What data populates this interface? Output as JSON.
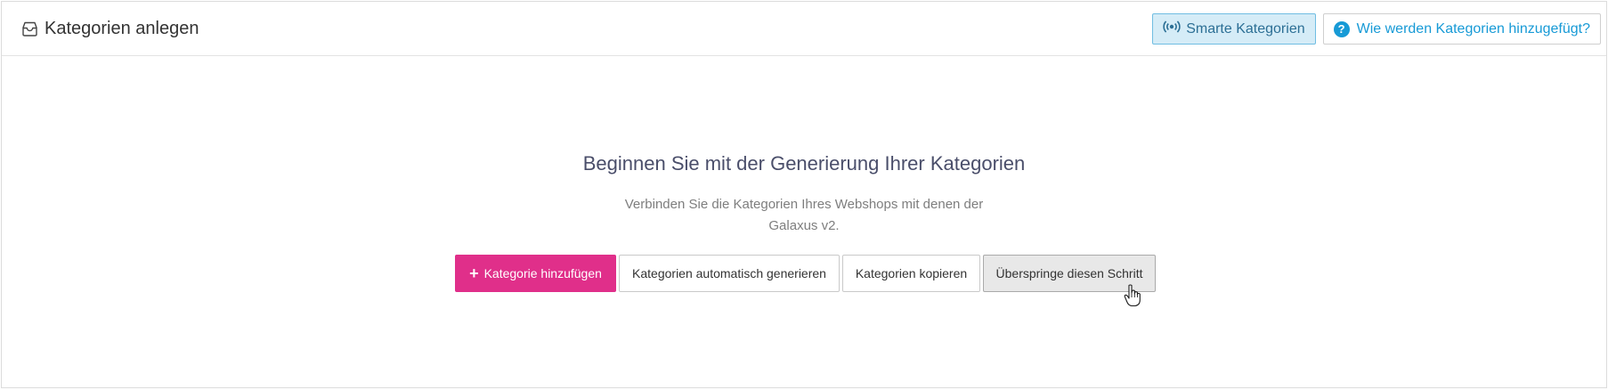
{
  "header": {
    "title": "Kategorien anlegen",
    "title_icon": "inbox-icon",
    "smart_button": {
      "label": "Smarte Kategorien",
      "icon": "broadcast-icon"
    },
    "help_button": {
      "label": "Wie werden Kategorien hinzugefügt?",
      "icon": "question-circle-icon",
      "icon_glyph": "?"
    }
  },
  "empty_state": {
    "title": "Beginnen Sie mit der Generierung Ihrer Kategorien",
    "description_line1": "Verbinden Sie die Kategorien Ihres Webshops mit denen der",
    "description_line2": "Galaxus v2."
  },
  "actions": {
    "add": {
      "label": "Kategorie hinzufügen",
      "icon": "plus-icon",
      "icon_glyph": "+"
    },
    "auto": {
      "label": "Kategorien automatisch generieren"
    },
    "copy": {
      "label": "Kategorien kopieren"
    },
    "skip": {
      "label": "Überspringe diesen Schritt"
    }
  },
  "colors": {
    "primary": "#e02f8a",
    "info": "#179ad6",
    "smart_bg": "#d5ecf7",
    "title_text": "#4a4e6a"
  }
}
